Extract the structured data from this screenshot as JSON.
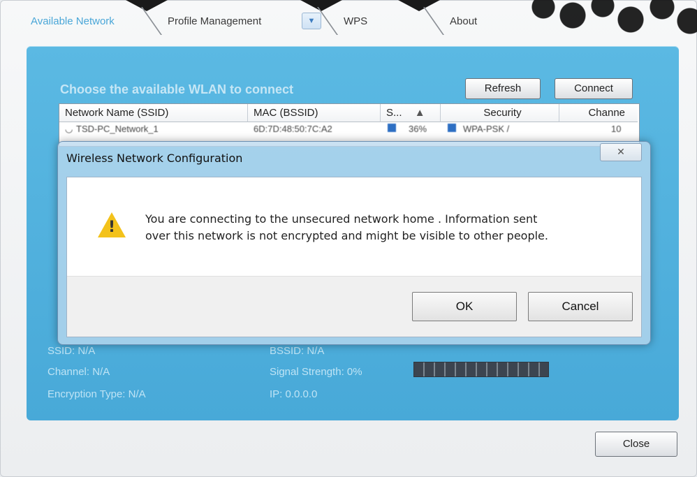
{
  "tabs": [
    {
      "label": "Available Network",
      "active": true
    },
    {
      "label": "Profile Management",
      "active": false
    },
    {
      "label": "WPS",
      "active": false
    },
    {
      "label": "About",
      "active": false
    }
  ],
  "panel": {
    "title": "Choose the available WLAN to connect",
    "refresh_label": "Refresh",
    "connect_label": "Connect",
    "columns": [
      "Network Name (SSID)",
      "MAC (BSSID)",
      "S...",
      "Security",
      "Channe"
    ],
    "rows": [
      {
        "ssid": "TSD-PC_Network_1",
        "mac": "6D:7D:48:50:7C:A2",
        "signal": "36%",
        "security": "WPA-PSK /",
        "channel": "10"
      }
    ]
  },
  "info": {
    "ssid": "SSID: N/A",
    "bssid": "BSSID: N/A",
    "channel": "Channel: N/A",
    "signal": "Signal Strength: 0%",
    "encryption": "Encryption Type: N/A",
    "ip": "IP: 0.0.0.0"
  },
  "close_label": "Close",
  "dialog": {
    "title": "Wireless Network Configuration",
    "close_glyph": "✕",
    "message_line1": "You are connecting to the unsecured network  home  . Information sent",
    "message_line2": "over this network is not encrypted and might be visible to other people.",
    "ok_label": "OK",
    "cancel_label": "Cancel"
  },
  "colors": {
    "panel_blue": "#4eaedb",
    "warning_yellow": "#f3c21b",
    "tab_active": "#4aa7d8"
  }
}
